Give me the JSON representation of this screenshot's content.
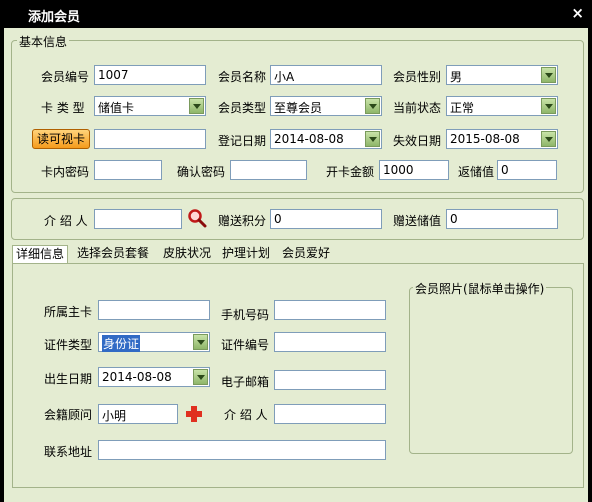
{
  "window": {
    "title": "添加会员",
    "close_glyph": "×"
  },
  "basic": {
    "legend": "基本信息",
    "member_no": {
      "label": "会员编号",
      "value": "1007"
    },
    "member_name": {
      "label": "会员名称",
      "value": "小A"
    },
    "gender": {
      "label": "会员性别",
      "value": "男"
    },
    "card_type": {
      "label": "卡 类 型",
      "value": "储值卡"
    },
    "member_type": {
      "label": "会员类型",
      "value": "至尊会员"
    },
    "status": {
      "label": "当前状态",
      "value": "正常"
    },
    "read_card_button": "读可视卡",
    "card_input": {
      "value": ""
    },
    "register_date": {
      "label": "登记日期",
      "value": "2014-08-08"
    },
    "expire_date": {
      "label": "失效日期",
      "value": "2015-08-08"
    },
    "card_password": {
      "label": "卡内密码",
      "value": ""
    },
    "confirm_password": {
      "label": "确认密码",
      "value": ""
    },
    "open_amount": {
      "label": "开卡金额",
      "value": "1000"
    },
    "rebate_value": {
      "label": "返储值",
      "value": "0"
    }
  },
  "referral": {
    "referrer": {
      "label": "介 绍 人",
      "value": ""
    },
    "bonus_points": {
      "label": "赠送积分",
      "value": "0"
    },
    "bonus_stored": {
      "label": "赠送储值",
      "value": "0"
    }
  },
  "tabs": [
    {
      "label": "详细信息",
      "active": true
    },
    {
      "label": "选择会员套餐",
      "active": false
    },
    {
      "label": "皮肤状况",
      "active": false
    },
    {
      "label": "护理计划",
      "active": false
    },
    {
      "label": "会员爱好",
      "active": false
    }
  ],
  "detail": {
    "primary_card": {
      "label": "所属主卡",
      "value": ""
    },
    "mobile": {
      "label": "手机号码",
      "value": ""
    },
    "id_type": {
      "label": "证件类型",
      "value": "身份证"
    },
    "id_number": {
      "label": "证件编号",
      "value": ""
    },
    "birth_date": {
      "label": "出生日期",
      "value": "2014-08-08"
    },
    "email": {
      "label": "电子邮箱",
      "value": ""
    },
    "consultant": {
      "label": "会籍顾问",
      "value": "小明"
    },
    "referrer2": {
      "label": "介 绍 人",
      "value": ""
    },
    "address": {
      "label": "联系地址",
      "value": ""
    },
    "photo_legend": "会员照片(鼠标单击操作)"
  },
  "colors": {
    "title_bar": "#000000",
    "panel_bg": "#e4ecd2",
    "button_orange": "#f59b1c",
    "plus_red": "#e03020"
  },
  "icons": {
    "search": "magnifier-icon",
    "add": "plus-icon"
  }
}
